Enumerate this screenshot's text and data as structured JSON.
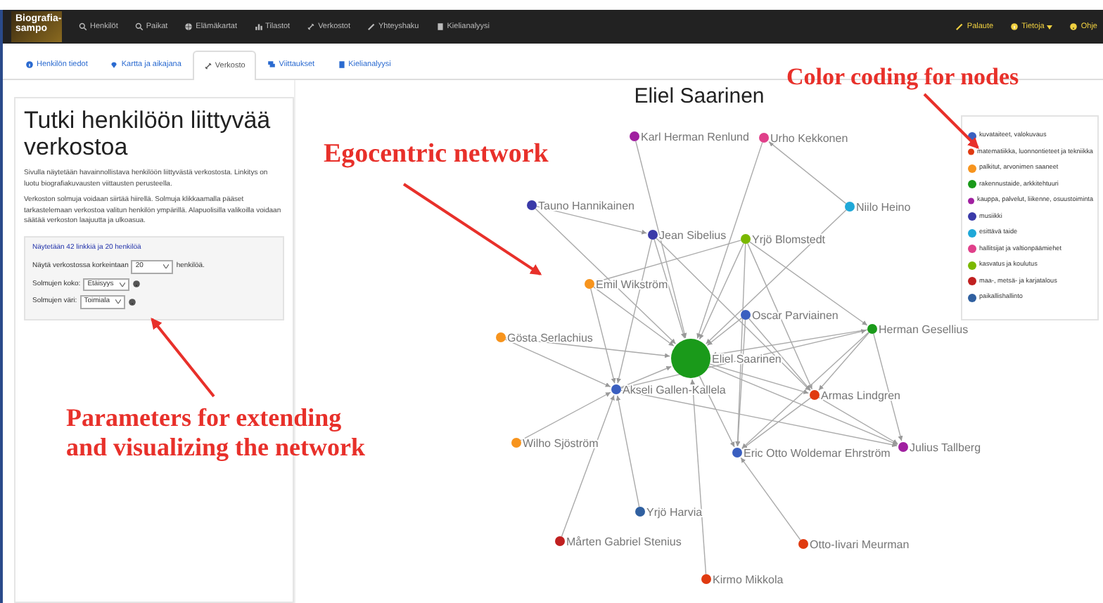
{
  "navbar": {
    "brand": "Biografia-sampo",
    "items": [
      {
        "label": "Henkilöt"
      },
      {
        "label": "Paikat"
      },
      {
        "label": "Elämäkartat"
      },
      {
        "label": "Tilastot"
      },
      {
        "label": "Verkostot"
      },
      {
        "label": "Yhteyshaku"
      },
      {
        "label": "Kielianalyysi"
      }
    ],
    "right_items": [
      {
        "label": "Palaute",
        "dropdown": false
      },
      {
        "label": "Tietoja",
        "dropdown": true
      },
      {
        "label": "Ohje",
        "dropdown": false
      }
    ]
  },
  "tabs": [
    {
      "label": "Henkilön tiedot",
      "selected": false
    },
    {
      "label": "Kartta ja aikajana",
      "selected": false
    },
    {
      "label": "Verkosto",
      "selected": true
    },
    {
      "label": "Viittaukset",
      "selected": false
    },
    {
      "label": "Kielianalyysi",
      "selected": false
    }
  ],
  "person_title": "Eliel Saarinen",
  "panel": {
    "title": "Tutki henkilöön liittyvää verkostoa",
    "paragraphs": [
      "Sivulla näytetään havainnollistava henkilöön liittyvästä verkostosta. Linkitys on luotu biografiakuvausten viittausten perusteella.",
      "Verkoston solmuja voidaan siirtää hiirellä. Solmuja klikkaamalla pääset tarkastelemaan verkostoa valitun henkilön ympärillä. Alapuolisilla valikoilla voidaan säätää verkoston laajuutta ja ulkoasua."
    ],
    "summary": "Näytetään 42 linkkiä ja 20 henkilöä",
    "controls": [
      {
        "label": "Näytä verkostossa korkeintaan",
        "value": "20",
        "suffix": "henkilöä.",
        "info": false
      },
      {
        "label": "Solmujen koko:",
        "value": "Etäisyys",
        "info": true
      },
      {
        "label": "Solmujen väri:",
        "value": "Toimiala",
        "info": true
      }
    ]
  },
  "network": {
    "nodes": [
      {
        "name": "Karl Herman Renlund",
        "color": "#a020a0"
      },
      {
        "name": "Urho Kekkonen",
        "color": "#e0408a"
      },
      {
        "name": "Tauno Hannikainen",
        "color": "#3a3aa8"
      },
      {
        "name": "Niilo Heino",
        "color": "#1fa8d8"
      },
      {
        "name": "Jean Sibelius",
        "color": "#3a3aa8"
      },
      {
        "name": "Yrjö Blomstedt",
        "color": "#7ab800"
      },
      {
        "name": "Emil Wikström",
        "color": "#f7941d"
      },
      {
        "name": "Oscar Parviainen",
        "color": "#3a5fc0"
      },
      {
        "name": "Herman Gesellius",
        "color": "#1a9a1a"
      },
      {
        "name": "Gösta Serlachius",
        "color": "#f7941d"
      },
      {
        "name": "Eliel Saarinen",
        "color": "#1a9a1a"
      },
      {
        "name": "Akseli Gallen-Kallela",
        "color": "#3a5fc0"
      },
      {
        "name": "Armas Lindgren",
        "color": "#e03a10"
      },
      {
        "name": "Wilho Sjöström",
        "color": "#f7941d"
      },
      {
        "name": "Eric Otto Woldemar Ehrström",
        "color": "#3a5fc0"
      },
      {
        "name": "Julius Tallberg",
        "color": "#a020a0"
      },
      {
        "name": "Yrjö Harvia",
        "color": "#3060a0"
      },
      {
        "name": "Mårten Gabriel Stenius",
        "color": "#c02020"
      },
      {
        "name": "Otto-Iivari Meurman",
        "color": "#e03a10"
      },
      {
        "name": "Kirmo Mikkola",
        "color": "#e03a10"
      }
    ],
    "legend": [
      {
        "label": "kuvataiteet, valokuvaus",
        "color": "#3a5fc0"
      },
      {
        "label": "matematiikka, luonnontieteet ja tekniikka",
        "color": "#e03a10"
      },
      {
        "label": "palkitut, arvonimen saaneet",
        "color": "#f7941d"
      },
      {
        "label": "rakennustaide, arkkitehtuuri",
        "color": "#1a9a1a"
      },
      {
        "label": "kauppa, palvelut, liikenne, osuustoiminta",
        "color": "#a020a0"
      },
      {
        "label": "musiikki",
        "color": "#3a3aa8"
      },
      {
        "label": "esittävä taide",
        "color": "#1fa8d8"
      },
      {
        "label": "hallitsijat ja valtionpäämiehet",
        "color": "#e0408a"
      },
      {
        "label": "kasvatus ja koulutus",
        "color": "#7ab800"
      },
      {
        "label": "maa-, metsä- ja karjatalous",
        "color": "#c02020"
      },
      {
        "label": "paikallishallinto",
        "color": "#3060a0"
      }
    ]
  },
  "annotations": [
    {
      "lines": [
        "Color coding for nodes"
      ]
    },
    {
      "lines": [
        "Egocentric network"
      ]
    },
    {
      "lines": [
        "Parameters for extending",
        "and visualizing the network"
      ]
    }
  ]
}
